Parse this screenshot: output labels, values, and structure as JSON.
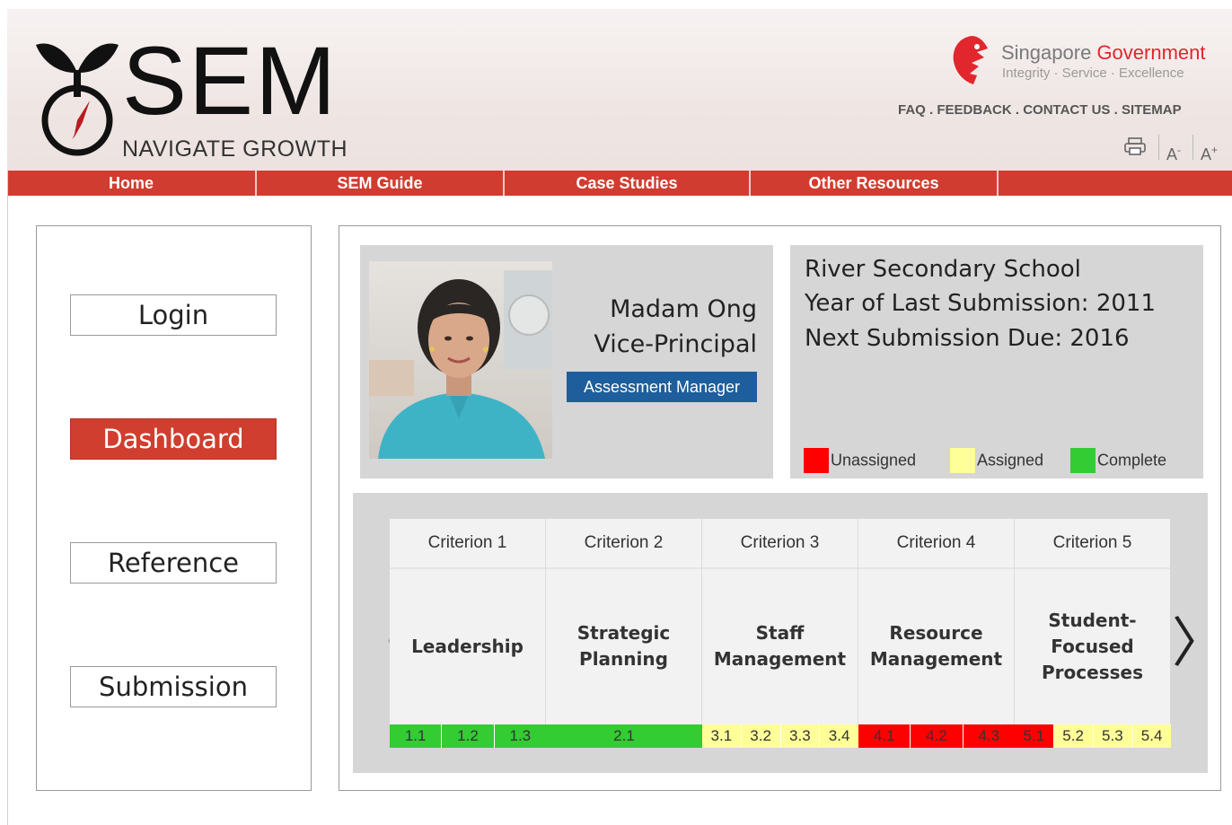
{
  "header": {
    "logo_text": "SEM",
    "logo_tagline": "NAVIGATE GROWTH",
    "gov_name_1": "Singapore",
    "gov_name_2": "Government",
    "gov_tagline": "Integrity · Service · Excellence",
    "top_links": [
      "FAQ",
      "FEEDBACK",
      "CONTACT US",
      "SITEMAP"
    ],
    "link_separator": ".",
    "tools": {
      "print_icon": "printer-icon",
      "decrease_font_label": "A",
      "decrease_mark": "-",
      "increase_font_label": "A",
      "increase_mark": "+"
    }
  },
  "nav": {
    "items": [
      "Home",
      "SEM Guide",
      "Case Studies",
      "Other Resources",
      ""
    ]
  },
  "sidebar": {
    "items": [
      {
        "label": "Login",
        "active": false
      },
      {
        "label": "Dashboard",
        "active": true
      },
      {
        "label": "Reference",
        "active": false
      },
      {
        "label": "Submission",
        "active": false
      }
    ]
  },
  "profile": {
    "name": "Madam Ong",
    "title": "Vice-Principal",
    "role": "Assessment Manager"
  },
  "school": {
    "name": "River Secondary School",
    "last_submission": "Year of Last Submission: 2011",
    "next_due": "Next Submission Due: 2016"
  },
  "legend": [
    {
      "label": "Unassigned",
      "color": "#ff0000"
    },
    {
      "label": "Assigned",
      "color": "#ffff99"
    },
    {
      "label": "Complete",
      "color": "#33cc33"
    }
  ],
  "status_colors": {
    "unassigned": "#ff0000",
    "assigned": "#ffff99",
    "complete": "#33cc33"
  },
  "criteria": [
    {
      "header": "Criterion 1",
      "name": "Leadership",
      "subs": [
        {
          "code": "1.1",
          "status": "complete"
        },
        {
          "code": "1.2",
          "status": "complete"
        },
        {
          "code": "1.3",
          "status": "complete"
        }
      ]
    },
    {
      "header": "Criterion 2",
      "name": "Strategic\nPlanning",
      "subs": [
        {
          "code": "2.1",
          "status": "complete"
        }
      ]
    },
    {
      "header": "Criterion 3",
      "name": "Staff\nManagement",
      "subs": [
        {
          "code": "3.1",
          "status": "assigned"
        },
        {
          "code": "3.2",
          "status": "assigned"
        },
        {
          "code": "3.3",
          "status": "assigned"
        },
        {
          "code": "3.4",
          "status": "assigned"
        }
      ]
    },
    {
      "header": "Criterion 4",
      "name": "Resource\nManagement",
      "subs": [
        {
          "code": "4.1",
          "status": "unassigned"
        },
        {
          "code": "4.2",
          "status": "unassigned"
        },
        {
          "code": "4.3",
          "status": "unassigned"
        }
      ]
    },
    {
      "header": "Criterion 5",
      "name": "Student-\nFocused\nProcesses",
      "subs": [
        {
          "code": "5.1",
          "status": "unassigned"
        },
        {
          "code": "5.2",
          "status": "assigned"
        },
        {
          "code": "5.3",
          "status": "assigned"
        },
        {
          "code": "5.4",
          "status": "assigned"
        }
      ]
    }
  ],
  "carousel": {
    "prev_icon": "chevron-left-icon",
    "next_icon": "chevron-right-icon",
    "prev_glyph": "〈",
    "next_glyph": "〉"
  }
}
